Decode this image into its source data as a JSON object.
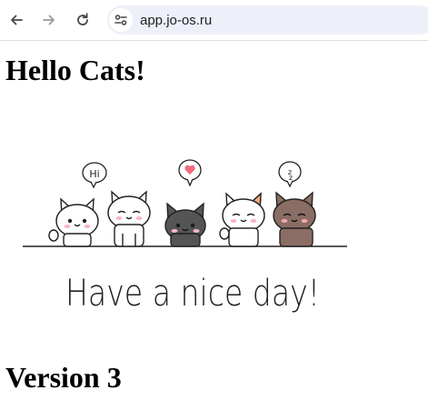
{
  "browser": {
    "back_icon": "arrow-left-icon",
    "forward_icon": "arrow-right-icon",
    "reload_icon": "reload-icon",
    "site_info_icon": "tune-icon",
    "url": "app.jo-os.ru"
  },
  "page": {
    "heading": "Hello Cats!",
    "image": {
      "speech_bubbles": [
        "Hi",
        "heart",
        "zz"
      ],
      "caption": "Have a nice day!",
      "cat_colors": [
        "#ffffff",
        "#ffffff",
        "#555555",
        "#ffffff",
        "#8a6d64"
      ]
    },
    "version_heading": "Version 3"
  },
  "colors": {
    "toolbar_bg": "#ffffff",
    "omnibox_bg": "#edf0f8",
    "heart": "#f06b7e"
  }
}
